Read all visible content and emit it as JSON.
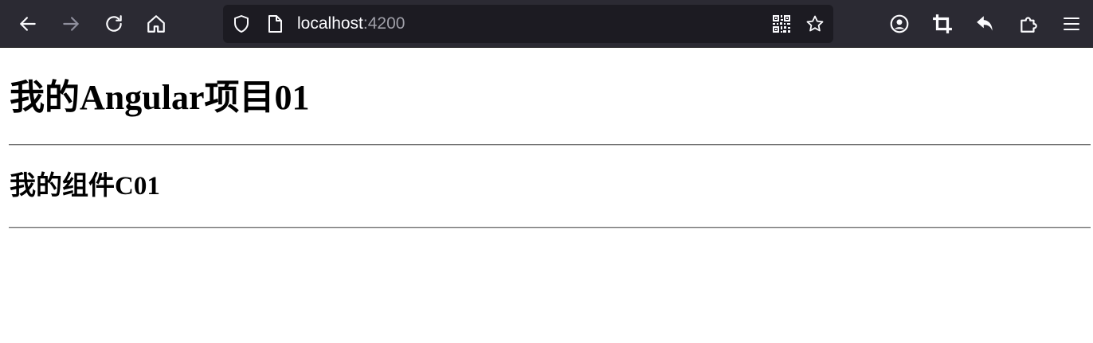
{
  "browser": {
    "url": {
      "host": "localhost",
      "port": ":4200"
    },
    "toolbar_icons": [
      "back-arrow-icon",
      "forward-arrow-icon",
      "reload-icon",
      "home-icon",
      "shield-icon",
      "page-icon",
      "qr-code-icon",
      "bookmark-star-icon",
      "account-icon",
      "crop-icon",
      "undo-icon",
      "extensions-icon",
      "menu-icon"
    ],
    "colors": {
      "toolbar_bg": "#2b2a33",
      "urlbar_bg": "#1c1b22",
      "icon": "#fbfbfe",
      "icon_disabled": "#8f8f9d"
    }
  },
  "page": {
    "heading1": "我的Angular项目01",
    "heading2": "我的组件C01"
  }
}
